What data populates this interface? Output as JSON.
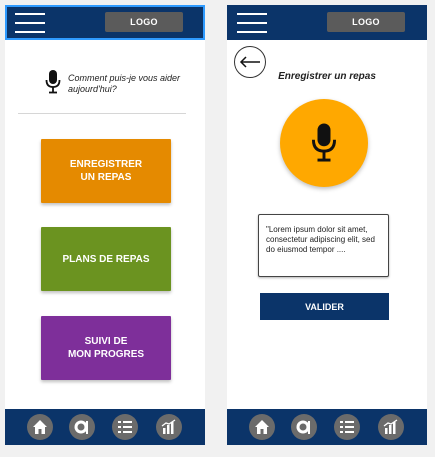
{
  "header": {
    "logo_label": "LOGO"
  },
  "home": {
    "assistant_prompt": "Comment puis-je vous aider aujourd'hui?",
    "buttons": [
      {
        "label": "ENREGISTRER\nUN REPAS",
        "color": "#e58a00"
      },
      {
        "label": "PLANS DE REPAS",
        "color": "#6b9320"
      },
      {
        "label": "SUIVI DE\nMON PROGRES",
        "color": "#7e2f9a"
      }
    ]
  },
  "record_meal": {
    "title": "Enregistrer un repas",
    "transcript": "\"Lorem ipsum dolor sit amet, consectetur adipiscing elit, sed do eiusmod tempor ....",
    "validate_label": "VALIDER",
    "mic_color": "#ffa800"
  },
  "bottom_nav": {
    "items": [
      {
        "icon": "home-icon"
      },
      {
        "icon": "meal-icon"
      },
      {
        "icon": "list-icon"
      },
      {
        "icon": "chart-icon"
      }
    ]
  },
  "colors": {
    "navy": "#0b3469",
    "selection": "#2f9bff",
    "icon_gray": "#6b6b6b"
  }
}
